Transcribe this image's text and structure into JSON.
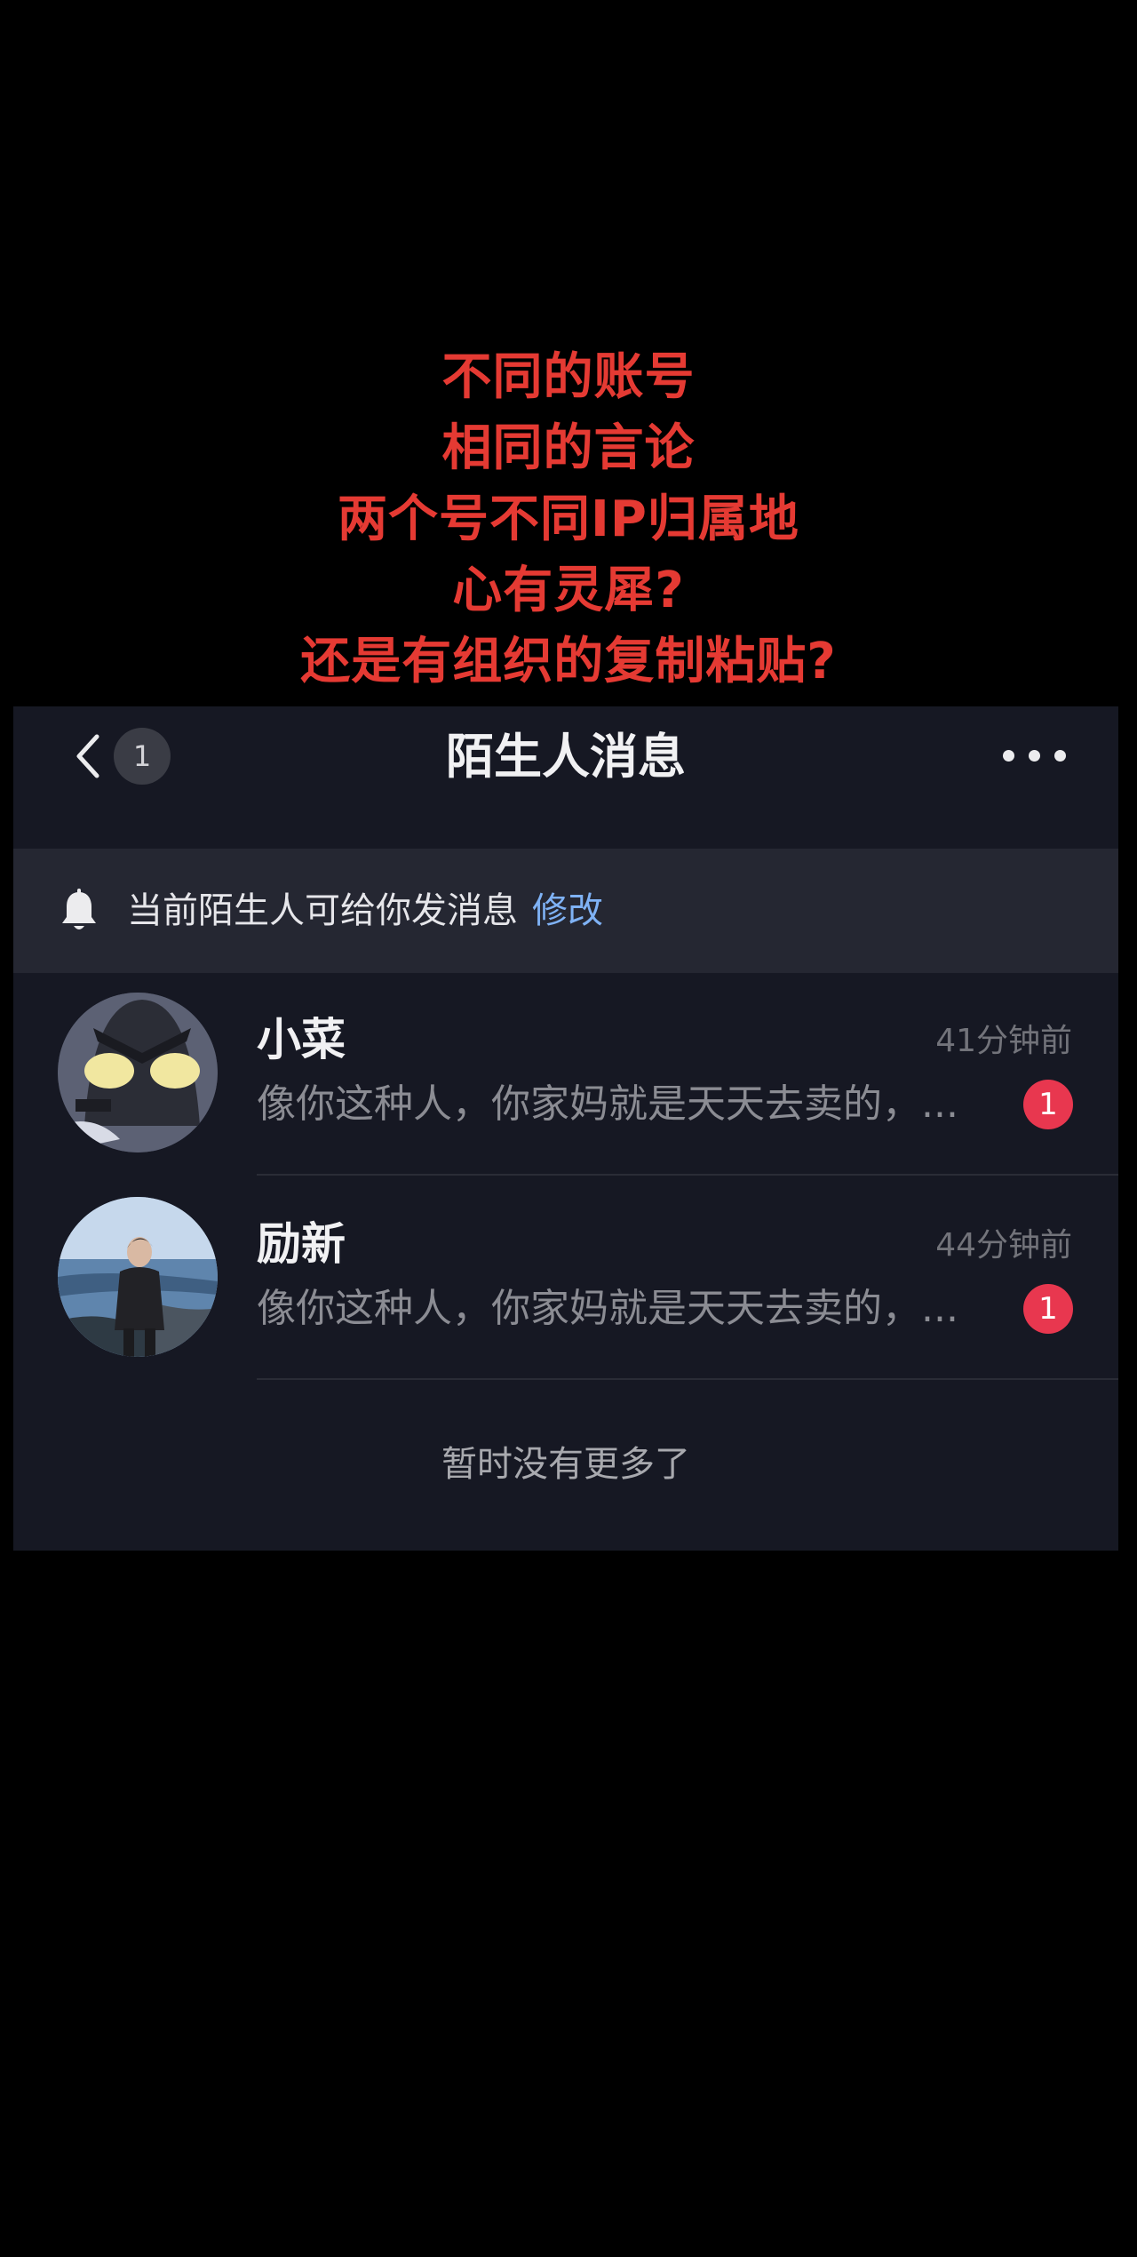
{
  "caption": {
    "lines": [
      "不同的账号",
      "相同的言论",
      "两个号不同IP归属地",
      "心有灵犀?",
      "还是有组织的复制粘贴?"
    ],
    "color": "#e53a33"
  },
  "header": {
    "back_icon": "chevron-left-icon",
    "unread_count": "1",
    "title": "陌生人消息",
    "more_icon": "more-horizontal-icon"
  },
  "notice": {
    "icon": "bell-icon",
    "text": "当前陌生人可给你发消息",
    "link_label": "修改",
    "link_color": "#7fb2f5"
  },
  "messages": [
    {
      "name": "小菜",
      "time": "41分钟前",
      "preview": "像你这种人，你家妈就是天天去卖的，...",
      "badge": "1",
      "avatar": "masked-character-avatar"
    },
    {
      "name": "励新",
      "time": "44分钟前",
      "preview": "像你这种人，你家妈就是天天去卖的，...",
      "badge": "1",
      "avatar": "person-by-sea-avatar"
    }
  ],
  "footer": {
    "end_text": "暂时没有更多了"
  },
  "colors": {
    "background": "#000000",
    "panel": "#161823",
    "notice_bg": "#252732",
    "badge": "#e8374f"
  }
}
